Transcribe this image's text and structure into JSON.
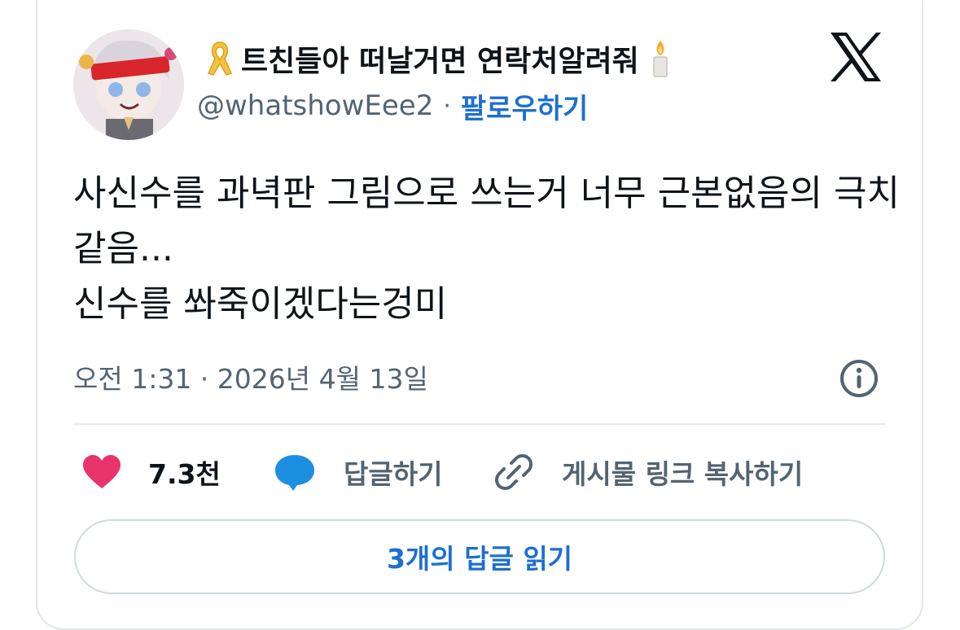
{
  "author": {
    "display_name": "트친들아 떠날거면 연락처알려줘",
    "name_prefix_icon": "yellow-ribbon-icon",
    "name_suffix_icon": "candle-icon",
    "handle": "@whatshowEee2",
    "separator": "·",
    "follow_label": "팔로우하기",
    "avatar": "anime-character-avatar"
  },
  "platform_logo": "x-logo-icon",
  "tweet": {
    "lines": [
      "사신수를 과녁판 그림으로 쓰는거 너무 근본없음의 극치",
      "같음...",
      "신수를 쏴죽이겠다는겅미"
    ]
  },
  "meta": {
    "timestamp": "오전 1:31 · 2026년 4월 13일",
    "info_icon": "info-icon"
  },
  "actions": {
    "like_count": "7.3천",
    "reply_label": "답글하기",
    "copy_link_label": "게시물 링크 복사하기"
  },
  "read_replies_label": "3개의 답글 읽기",
  "colors": {
    "text": "#0f1419",
    "secondary": "#536471",
    "link": "#1d6fd1",
    "like": "#e8336b",
    "reply": "#1d8fe0",
    "border": "#cfd9de"
  }
}
